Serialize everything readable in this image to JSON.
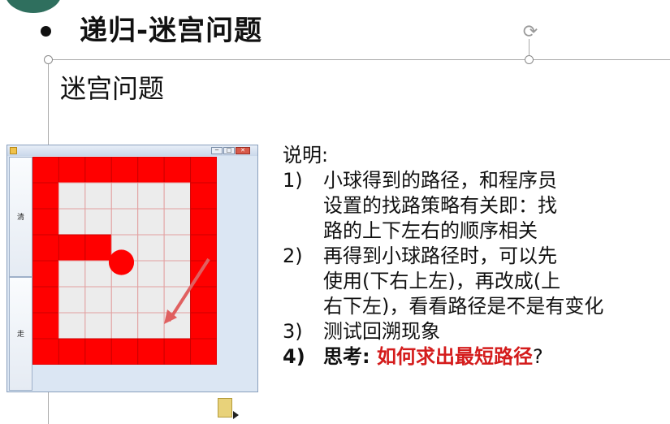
{
  "slide": {
    "title": "递归-迷宫问题",
    "subtitle": "迷宫问题"
  },
  "app": {
    "buttons": [
      {
        "label": "清"
      },
      {
        "label": "走"
      }
    ],
    "window_controls": [
      "─",
      "□",
      "✕"
    ]
  },
  "maze": {
    "rows": 8,
    "cols": 7,
    "wall_color": "#ff0000",
    "floor_color": "#ececec",
    "ball_color": "#ff0000",
    "arrow_color": "#e06060",
    "walls": [
      [
        1,
        1,
        1,
        1,
        1,
        1,
        1
      ],
      [
        1,
        0,
        0,
        0,
        0,
        0,
        1
      ],
      [
        1,
        0,
        0,
        0,
        0,
        0,
        1
      ],
      [
        1,
        1,
        1,
        0,
        0,
        0,
        1
      ],
      [
        1,
        0,
        0,
        0,
        0,
        0,
        1
      ],
      [
        1,
        0,
        0,
        0,
        0,
        0,
        1
      ],
      [
        1,
        0,
        0,
        0,
        0,
        0,
        1
      ],
      [
        1,
        1,
        1,
        1,
        1,
        1,
        1
      ]
    ],
    "ball": {
      "row": 4,
      "col": 3
    }
  },
  "notes": {
    "heading": "说明:",
    "items": [
      {
        "num": "1)",
        "lines": [
          "小球得到的路径，和程序员",
          "设置的找路策略有关即：找",
          "路的上下左右的顺序相关"
        ]
      },
      {
        "num": "2)",
        "lines": [
          "再得到小球路径时，可以先",
          "使用(下右上左)，再改成(上",
          "右下左)，看看路径是不是有变化"
        ]
      },
      {
        "num": "3)",
        "lines": [
          "测试回溯现象"
        ]
      },
      {
        "num": "4)",
        "prefix": "思考: ",
        "highlight": "如何求出最短路径",
        "suffix": "?"
      }
    ]
  }
}
